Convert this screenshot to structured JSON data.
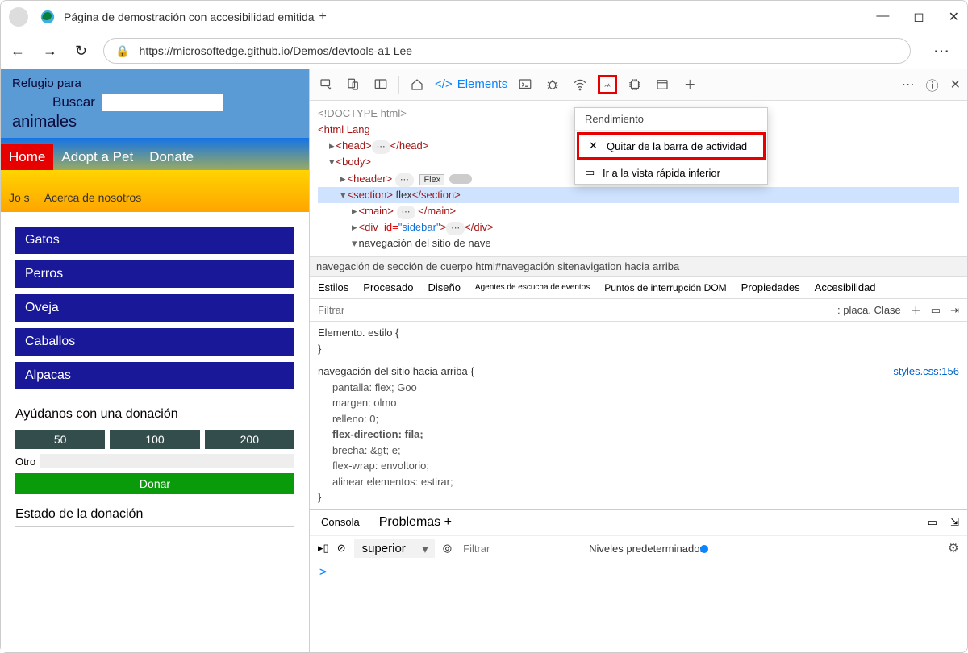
{
  "window": {
    "tab_title": "Página de demostración con accesibilidad emitida",
    "plus": "+"
  },
  "address": {
    "url": "https://microsoftedge.github.io/Demos/devtools-a1 Lee"
  },
  "page": {
    "header": {
      "refugio": "Refugio para",
      "animales": "animales",
      "buscar": "Buscar"
    },
    "nav1": {
      "home": "Home",
      "adopt": "Adopt a Pet",
      "donate": "Donate"
    },
    "nav2": {
      "jos": "Jo s",
      "about": "Acerca de nosotros"
    },
    "side": [
      "Gatos",
      "Perros",
      "Oveja",
      "Caballos",
      "Alpacas"
    ],
    "donation": {
      "title": "Ayúdanos con una donación",
      "amounts": [
        "50",
        "100",
        "200"
      ],
      "otro": "Otro",
      "donar": "Donar"
    },
    "status_title": "Estado de la donación"
  },
  "devtools": {
    "toolbar": {
      "elements": "Elements"
    },
    "ctxmenu": {
      "header": "Rendimiento",
      "remove": "Quitar de la barra de actividad",
      "goto": "Ir a la vista rápida inferior"
    },
    "dom": {
      "doctype": "<!DOCTYPE html>",
      "html_open": "<html Lang",
      "head": "<head>",
      "head_close": "</head>",
      "body": "<body>",
      "header": "<header>",
      "flex": "Flex",
      "section": "<section>",
      "section_text": "flex",
      "section_close": "</section>",
      "main": "<main>",
      "main_close": "</main>",
      "div": "<div",
      "div_id": "id=",
      "div_idval": "\"sidebar\"",
      "div_close": "</div>",
      "nav_text": "navegación del sitio de nave"
    },
    "crumb": "navegación de sección de cuerpo html#navegación sitenavigation hacia arriba",
    "style_tabs": {
      "estilos": "Estilos",
      "procesado": "Procesado",
      "diseno": "Diseño",
      "agentes": "Agentes de escucha de eventos",
      "puntos": "Puntos de interrupción DOM",
      "propiedades": "Propiedades",
      "accesibilidad": "Accesibilidad"
    },
    "filter": {
      "placeholder": "Filtrar",
      "placa": ": placa. Clase"
    },
    "styles": {
      "element_style": "Elemento. estilo {",
      "close": "}",
      "rule_sel": "navegación del sitio hacia arriba {",
      "link": "styles.css:156",
      "p1": "pantalla: flex; Goo",
      "p2": "margen: olmo",
      "p3": "relleno: 0;",
      "p4a": "flex-direction:",
      "p4b": "fila;",
      "p5": "brecha: &gt; e;",
      "p6": "flex-wrap: envoltorio;",
      "p7": "alinear elementos: estirar;"
    },
    "console": {
      "tab_console": "Consola",
      "tab_problems": "Problemas +",
      "context": "superior",
      "filter": "Filtrar",
      "levels": "Niveles predeterminados",
      "prompt": ">"
    }
  }
}
